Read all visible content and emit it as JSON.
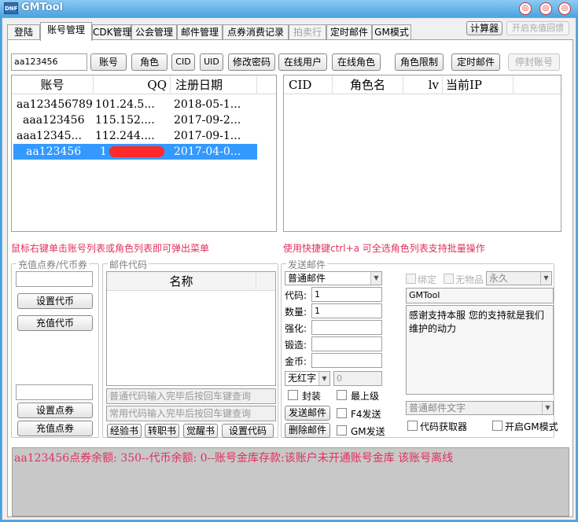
{
  "window": {
    "title": "GMTool",
    "icon_text": "DNF"
  },
  "tabs": [
    {
      "label": "登陆"
    },
    {
      "label": "账号管理"
    },
    {
      "label": "CDK管理"
    },
    {
      "label": "公会管理"
    },
    {
      "label": "邮件管理"
    },
    {
      "label": "点券消费记录"
    },
    {
      "label": "拍卖行"
    },
    {
      "label": "定时邮件"
    },
    {
      "label": "GM模式"
    }
  ],
  "header_buttons": {
    "calculator": "计算器",
    "disabled_btn": "开启充值回馈"
  },
  "search": {
    "value": "aa123456",
    "buttons": {
      "account": "账号",
      "role": "角色",
      "cid": "CID",
      "uid": "UID",
      "change_password": "修改密码",
      "online_users": "在线用户",
      "online_roles": "在线角色",
      "role_limit": "角色限制",
      "timed_mail": "定时邮件",
      "ban_account": "停封账号"
    }
  },
  "account_table": {
    "columns": [
      "账号",
      "QQ",
      "注册日期"
    ],
    "rows": [
      {
        "account": "aa123456789",
        "qq": "101.24.5...",
        "date": "2018-05-1..."
      },
      {
        "account": "aaa123456",
        "qq": "115.152....",
        "date": "2017-09-2..."
      },
      {
        "account": "aaa12345...",
        "qq": "112.244....",
        "date": "2017-09-1..."
      },
      {
        "account": "aa123456",
        "qq": "1",
        "date": "2017-04-0..."
      }
    ]
  },
  "role_table": {
    "columns": [
      "CID",
      "角色名",
      "lv",
      "当前IP"
    ]
  },
  "hints": {
    "left": "鼠标右键单击账号列表或角色列表即可弹出菜单",
    "right": "使用快捷键ctrl+a 可全选角色列表支持批量操作"
  },
  "recharge": {
    "label": "充值点券/代币券",
    "set_currency": "设置代币",
    "charge_currency": "充值代币",
    "set_points": "设置点券",
    "charge_points": "充值点券"
  },
  "mail_code": {
    "label": "邮件代码",
    "column": "名称",
    "normal_placeholder": "普通代码输入完毕后按回车键查询",
    "common_placeholder": "常用代码输入完毕后按回车键查询",
    "buttons": {
      "exp_book": "经验书",
      "job_book": "转职书",
      "awaken_book": "觉醒书",
      "set_code": "设置代码"
    }
  },
  "send_mail": {
    "label": "发送邮件",
    "mail_type": "普通邮件",
    "fields": {
      "code": "代码:",
      "qty": "数量:",
      "enhance": "强化:",
      "forge": "锻造:",
      "gold": "金币:"
    },
    "code_value": "1",
    "qty_value": "1",
    "no_red": "无红字",
    "red_value": "0",
    "seal": "封装",
    "top_level": "最上级",
    "send_btn": "发送邮件",
    "f4_send": "F4发送",
    "delete_btn": "删除邮件",
    "gm_send": "GM发送",
    "bind": "绑定",
    "no_trade": "无物品",
    "duration": "永久",
    "sender": "GMTool",
    "message": "感谢支持本服 您的支持就是我们维护的动力",
    "text_type": "普通邮件文字",
    "code_getter": "代码获取器",
    "gm_mode": "开启GM模式"
  },
  "status": {
    "log": "aa123456点券余额: 350--代币余额: 0--账号金库存款:该账户未开通账号金库 该账号离线"
  },
  "colors": {
    "accent": "#3399ff",
    "hint_red": "#e03060",
    "title_blue": "#4aa3df"
  }
}
